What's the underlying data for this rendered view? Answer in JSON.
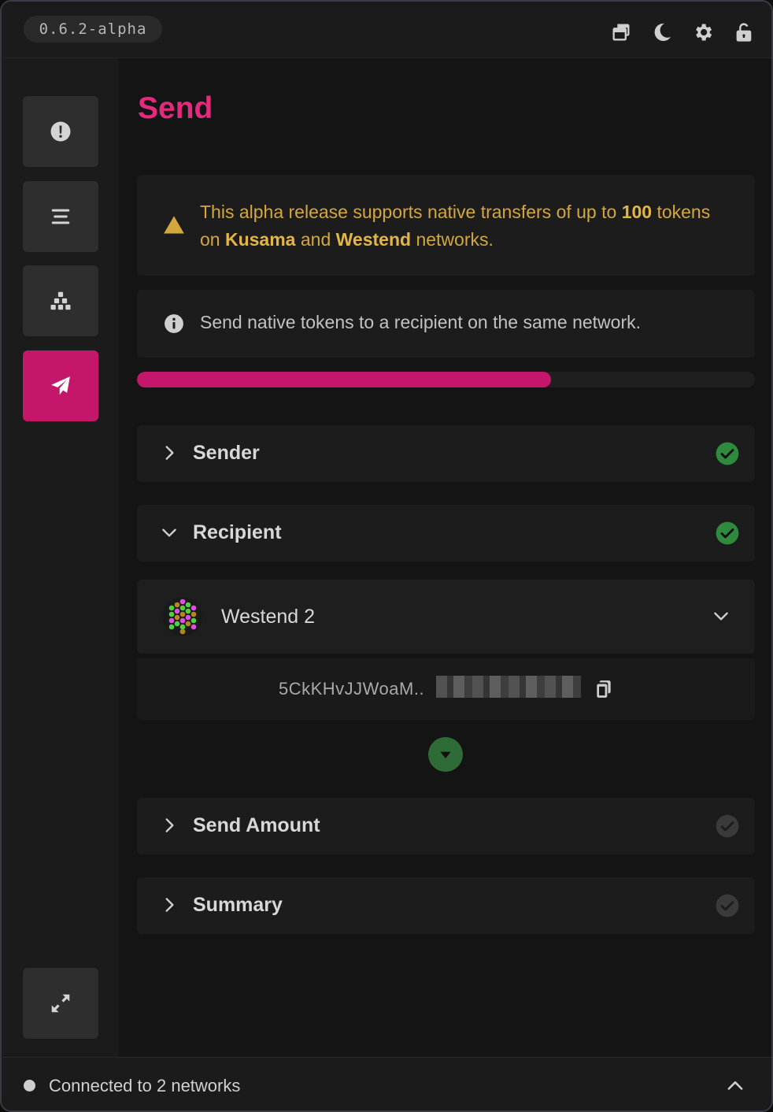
{
  "app": {
    "version": "0.6.2-alpha"
  },
  "topbar": {
    "icons": [
      "windows-icon",
      "moon-icon",
      "gear-icon",
      "unlock-icon"
    ]
  },
  "sidebar": {
    "items": [
      {
        "name": "info",
        "icon": "exclamation-circle-icon",
        "active": false
      },
      {
        "name": "menu",
        "icon": "bars-icon",
        "active": false
      },
      {
        "name": "cubes",
        "icon": "cubes-icon",
        "active": false
      },
      {
        "name": "send",
        "icon": "paper-plane-icon",
        "active": true
      }
    ],
    "bottom_icon": "expand-icon"
  },
  "page": {
    "title": "Send",
    "warning": {
      "part1": "This alpha release supports native transfers of up to ",
      "amount": "100",
      "part2": " tokens on ",
      "network1": "Kusama",
      "part3": " and ",
      "network2": "Westend",
      "part4": " networks."
    },
    "info": "Send native tokens to a recipient on the same network.",
    "progress_percent": 67,
    "sections": {
      "sender": {
        "label": "Sender",
        "complete": true,
        "expanded": false
      },
      "recipient": {
        "label": "Recipient",
        "complete": true,
        "expanded": true
      },
      "send_amount": {
        "label": "Send Amount",
        "complete": false,
        "expanded": false
      },
      "summary": {
        "label": "Summary",
        "complete": false,
        "expanded": false
      }
    },
    "recipient_account": {
      "name": "Westend 2",
      "address_prefix": "5CkKHvJJWoaM.."
    }
  },
  "status": {
    "text": "Connected to 2 networks"
  },
  "colors": {
    "accent": "#c4166b",
    "title": "#e5297c",
    "warning": "#d4a73c",
    "success": "#2e8b3e"
  }
}
